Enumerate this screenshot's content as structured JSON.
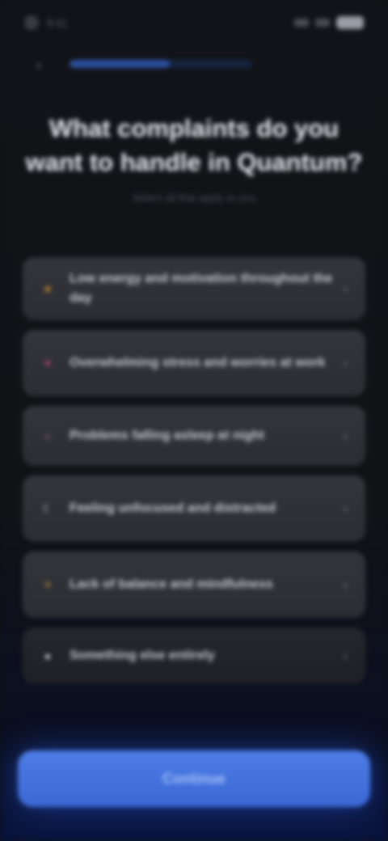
{
  "status_bar": {
    "time": "9:41"
  },
  "header": {
    "back_icon": "chevron-left-icon",
    "progress": 0.55
  },
  "title": "What complaints do you want to handle in Quantum?",
  "subtitle": "Select all that apply to you",
  "options": [
    {
      "icon": "star-icon",
      "icon_color": "#c98a2e",
      "label": "Low energy and motivation throughout the day",
      "height": 78
    },
    {
      "icon": "heart-icon",
      "icon_color": "#b3476a",
      "label": "Overwhelming stress and worries at work",
      "height": 82
    },
    {
      "icon": "circle-icon",
      "icon_color": "#6a4a58",
      "label": "Problems falling asleep at night",
      "height": 74
    },
    {
      "icon": "moon-icon",
      "icon_color": "#d6d7de",
      "label": "Feeling unfocused and distracted",
      "height": 82
    },
    {
      "icon": "sun-icon",
      "icon_color": "#a6803a",
      "label": "Lack of balance and mindfulness",
      "height": 82
    },
    {
      "icon": "dot-icon",
      "icon_color": "#d9dae0",
      "label": "Something else entirely",
      "height": 70
    }
  ],
  "continue_label": "Continue",
  "colors": {
    "accent": "#3f6fd9",
    "background": "#111216",
    "card": "#303137"
  }
}
